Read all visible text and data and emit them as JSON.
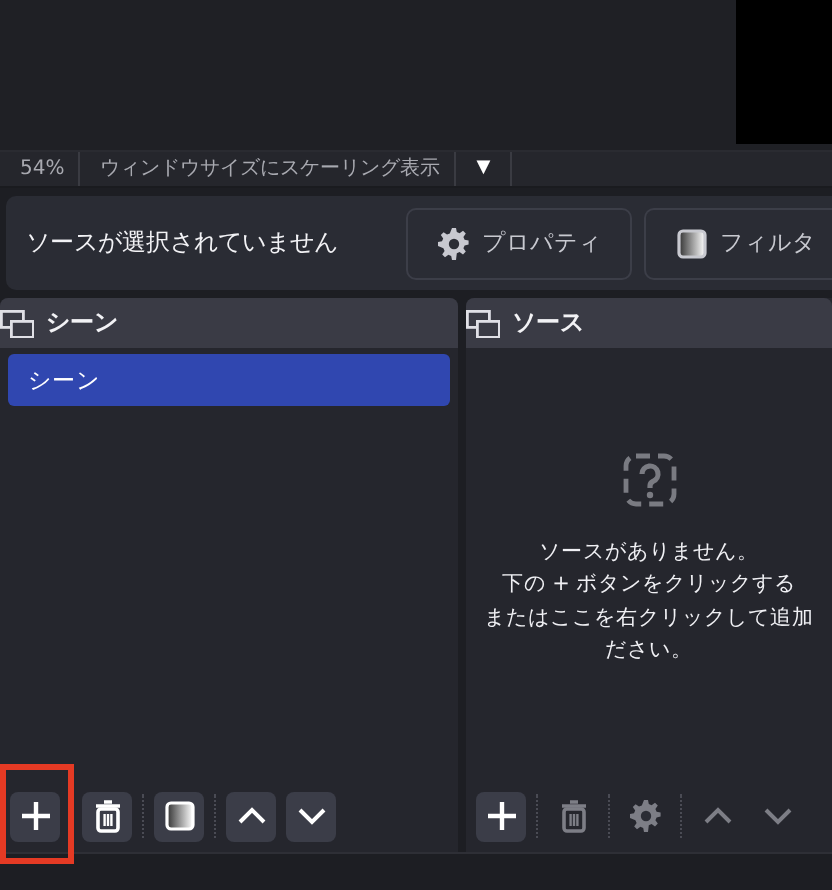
{
  "zoom_bar": {
    "zoom": "54%",
    "scale_mode": "ウィンドウサイズにスケーリング表示",
    "dropdown": "▼"
  },
  "context_bar": {
    "status": "ソースが選択されていません",
    "buttons": [
      {
        "kind": "gear",
        "label": "プロパティ"
      },
      {
        "kind": "filter",
        "label": "フィルタ"
      }
    ]
  },
  "scenes": {
    "title": "シーン",
    "items": [
      {
        "label": "シーン",
        "selected": true
      }
    ],
    "toolbar": [
      {
        "kind": "add",
        "disabled": false,
        "highlighted": true
      },
      {
        "kind": "remove",
        "disabled": false,
        "highlighted": false
      },
      {
        "kind": "filter",
        "disabled": false,
        "highlighted": false
      },
      {
        "kind": "up",
        "disabled": false,
        "highlighted": false
      },
      {
        "kind": "down",
        "disabled": false,
        "highlighted": false
      }
    ]
  },
  "sources": {
    "title": "ソース",
    "empty_message": [
      "ソースがありません。",
      "下の + ボタンをクリックする",
      "またはここを右クリックして追加",
      "ださい。"
    ],
    "toolbar": [
      {
        "kind": "add",
        "disabled": false,
        "highlighted": false
      },
      {
        "kind": "remove",
        "disabled": true,
        "highlighted": false
      },
      {
        "kind": "gear",
        "disabled": true,
        "highlighted": false
      },
      {
        "kind": "up",
        "disabled": true,
        "highlighted": false
      },
      {
        "kind": "down",
        "disabled": true,
        "highlighted": false
      }
    ]
  }
}
